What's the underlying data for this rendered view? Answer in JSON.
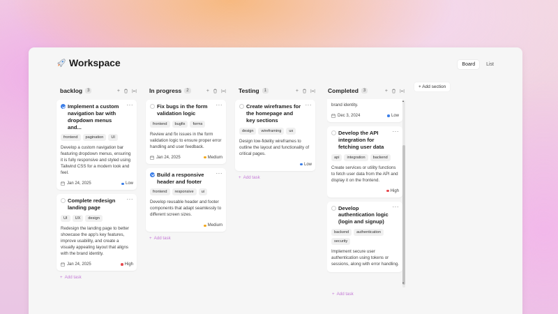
{
  "app": {
    "title": "Workspace",
    "logo_icon": "rocket-icon"
  },
  "views": {
    "board": "Board",
    "list": "List",
    "active": "Board"
  },
  "add_section_label": "Add section",
  "add_task_label": "Add task",
  "columns": [
    {
      "title": "backlog",
      "count": "3",
      "cards": [
        {
          "title": "Implement a custom navigation bar with dropdown menus and...",
          "done": true,
          "tags": [
            "frontend",
            "pagination",
            "UI"
          ],
          "description": "Develop a custom navigation bar featuring dropdown menus, ensuring it is fully responsive and styled using Tailwind CSS for a modern look and feel.",
          "date": "Jan 24, 2025",
          "priority": "Low"
        },
        {
          "title": "Complete redesign landing page",
          "done": false,
          "tags": [
            "UI",
            "UX",
            "design"
          ],
          "description": "Redesign the landing page to better showcase the app's key features, improve usability, and create a visually appealing layout that aligns with the brand identity.",
          "date": "Jan 24, 2025",
          "priority": "High"
        }
      ]
    },
    {
      "title": "In progress",
      "count": "2",
      "cards": [
        {
          "title": "Fix bugs in the form validation logic",
          "done": false,
          "tags": [
            "frontend",
            "bugfix",
            "forms"
          ],
          "description": "Review and fix issues in the form validation logic to ensure proper error handling and user feedback.",
          "date": "Jan 24, 2025",
          "priority": "Medium"
        },
        {
          "title": "Build a responsive header and footer",
          "done": true,
          "tags": [
            "frontend",
            "responsive",
            "ui"
          ],
          "description": "Develop reusable header and footer components that adapt seamlessly to different screen sizes.",
          "date": "",
          "priority": "Medium"
        }
      ]
    },
    {
      "title": "Testing",
      "count": "1",
      "cards": [
        {
          "title": "Create wireframes for the homepage and key sections",
          "done": false,
          "tags": [
            "design",
            "wireframing",
            "ux"
          ],
          "description": "Design low-fidelity wireframes to outline the layout and functionality of critical pages.",
          "date": "",
          "priority": "Low"
        }
      ]
    },
    {
      "title": "Completed",
      "count": "3",
      "partial_card": {
        "description": "brand identity.",
        "date": "Dec 3, 2024",
        "priority": "Low"
      },
      "cards": [
        {
          "title": "Develop the API integration for fetching user data",
          "done": false,
          "tags": [
            "api",
            "integration",
            "backend"
          ],
          "description": "Create services or utility functions to fetch user data from the API and display it on the frontend.",
          "date": "",
          "priority": "High"
        },
        {
          "title": "Develop authentication logic (login and signup)",
          "done": false,
          "tags": [
            "backend",
            "authentication",
            "security"
          ],
          "description": "Implement secure user authentication using tokens or sessions, along with error handling.",
          "date": "",
          "priority": ""
        }
      ]
    }
  ],
  "priority_colors": {
    "Low": "#3b7ee8",
    "Medium": "#f2a81d",
    "High": "#e5484d"
  },
  "accent": "#c47ad6"
}
